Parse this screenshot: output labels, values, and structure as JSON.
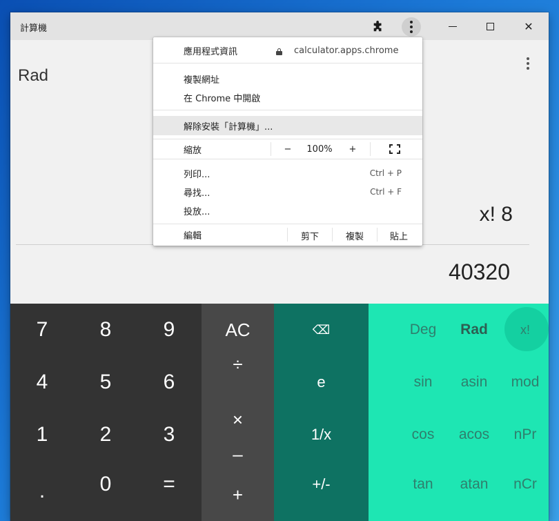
{
  "window": {
    "title": "計算機",
    "controls": {
      "minimize": "–",
      "maximize": "□",
      "close": "✕"
    }
  },
  "display": {
    "mode": "Rad",
    "expression": "x! 8",
    "result": "40320"
  },
  "keypad": {
    "numbers": [
      "7",
      "8",
      "9",
      "4",
      "5",
      "6",
      "1",
      "2",
      "3",
      ".",
      "0",
      "="
    ],
    "operators": [
      "AC",
      "÷",
      "×",
      "–",
      "+"
    ],
    "functions": [
      "⌫",
      "e",
      "1/x",
      "+/-"
    ],
    "scientific": [
      "Deg",
      "Rad",
      "x!",
      "sin",
      "asin",
      "mod",
      "cos",
      "acos",
      "nPr",
      "tan",
      "atan",
      "nCr"
    ]
  },
  "menu": {
    "app_info": "應用程式資訊",
    "url": "calculator.apps.chrome",
    "copy_url": "複製網址",
    "open_in_chrome": "在 Chrome 中開啟",
    "uninstall": "解除安裝「計算機」...",
    "zoom_label": "縮放",
    "zoom_minus": "−",
    "zoom_value": "100%",
    "zoom_plus": "+",
    "print": "列印...",
    "print_shortcut": "Ctrl + P",
    "find": "尋找...",
    "find_shortcut": "Ctrl + F",
    "cast": "投放...",
    "edit_label": "編輯",
    "cut": "剪下",
    "copy": "複製",
    "paste": "貼上"
  },
  "colors": {
    "numpad_bg": "#333333",
    "ops_bg": "#484848",
    "fn_bg": "#0e7262",
    "sci_bg": "#1ee6b3"
  }
}
